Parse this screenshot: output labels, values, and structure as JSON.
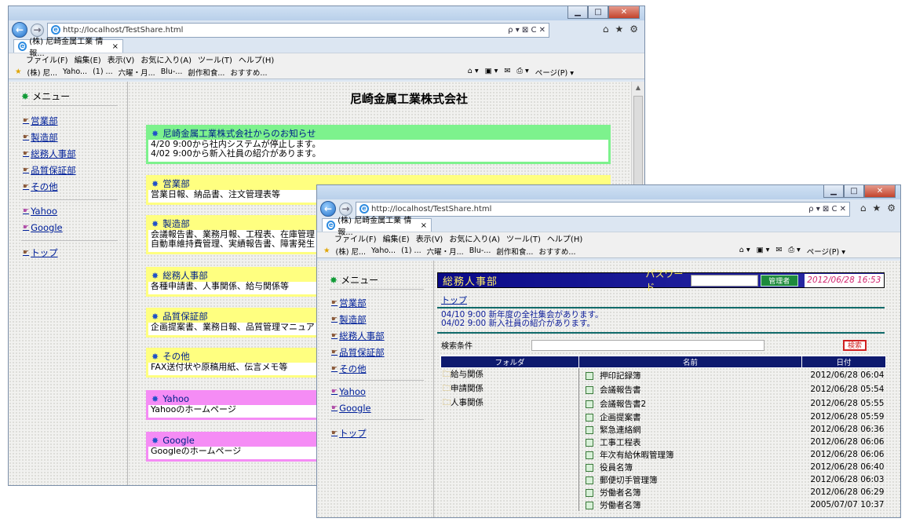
{
  "browser": {
    "url": "http://localhost/TestShare.html",
    "url_suffix": "ρ ▾ ⊠ C ✕",
    "tab_title": "(株) 尼崎金属工業 情報...",
    "tab_title_2": "(株) 尼崎金属工業 情報...",
    "menu": [
      "ファイル(F)",
      "編集(E)",
      "表示(V)",
      "お気に入り(A)",
      "ツール(T)",
      "ヘルプ(H)"
    ],
    "favorites": [
      "(株) 尼...",
      "Yaho...",
      "(1) ...",
      "六曜・月...",
      "Blu-...",
      "創作和食...",
      "おすすめ..."
    ],
    "page_tools": "ページ(P) ▾",
    "page_tools_2": "ページ(P) ▾"
  },
  "sidebar": {
    "header": "メニュー",
    "departments": [
      "営業部",
      "製造部",
      "総務人事部",
      "品質保証部",
      "その他"
    ],
    "external": [
      "Yahoo",
      "Google"
    ],
    "top": "トップ"
  },
  "main": {
    "company_title": "尼崎金属工業株式会社",
    "boxes": [
      {
        "title": "尼崎金属工業株式会社からのお知らせ",
        "lines": [
          "4/20 9:00から社内システムが停止します。",
          "4/02 9:00から新入社員の紹介があります。"
        ]
      },
      {
        "title": "営業部",
        "lines": [
          "営業日報、納品書、注文管理表等"
        ]
      },
      {
        "title": "製造部",
        "lines": [
          "会議報告書、業務月報、工程表、在庫管理",
          "自動車維持費管理、実績報告書、障害発生"
        ]
      },
      {
        "title": "総務人事部",
        "lines": [
          "各種申請書、人事関係、給与関係等"
        ]
      },
      {
        "title": "品質保証部",
        "lines": [
          "企画提案書、業務日報、品質管理マニュア"
        ]
      },
      {
        "title": "その他",
        "lines": [
          "FAX送付状や原稿用紙、伝言メモ等"
        ]
      },
      {
        "title": "Yahoo",
        "lines": [
          "Yahooのホームページ"
        ]
      },
      {
        "title": "Google",
        "lines": [
          "Googleのホームページ"
        ]
      }
    ]
  },
  "dept": {
    "title": "総務人事部",
    "password_label": "パスワード",
    "password_value": "",
    "admin_button": "管理者",
    "datetime": "2012/06/28 16:53",
    "top_link": "トップ",
    "announcements": [
      "04/10 9:00 新年度の全社集会があります。",
      "04/02 9:00 新入社員の紹介があります。"
    ],
    "search_label": "検索条件",
    "search_value": "",
    "search_button": "検索",
    "columns": [
      "フォルダ",
      "名前",
      "日付"
    ],
    "folders": [
      "給与関係",
      "申請関係",
      "人事関係"
    ],
    "files": [
      {
        "name": "押印記録簿",
        "date": "2012/06/28 06:04"
      },
      {
        "name": "会議報告書",
        "date": "2012/06/28 05:54"
      },
      {
        "name": "会議報告書2",
        "date": "2012/06/28 05:55"
      },
      {
        "name": "企画提案書",
        "date": "2012/06/28 05:59"
      },
      {
        "name": "緊急連絡網",
        "date": "2012/06/28 06:36"
      },
      {
        "name": "工事工程表",
        "date": "2012/06/28 06:06"
      },
      {
        "name": "年次有給休暇管理簿",
        "date": "2012/06/28 06:06"
      },
      {
        "name": "役員名簿",
        "date": "2012/06/28 06:40"
      },
      {
        "name": "郵便切手管理簿",
        "date": "2012/06/28 06:03"
      },
      {
        "name": "労働者名簿",
        "date": "2012/06/28 06:29"
      },
      {
        "name": "労働者名簿",
        "date": "2005/07/07 10:37"
      }
    ]
  }
}
